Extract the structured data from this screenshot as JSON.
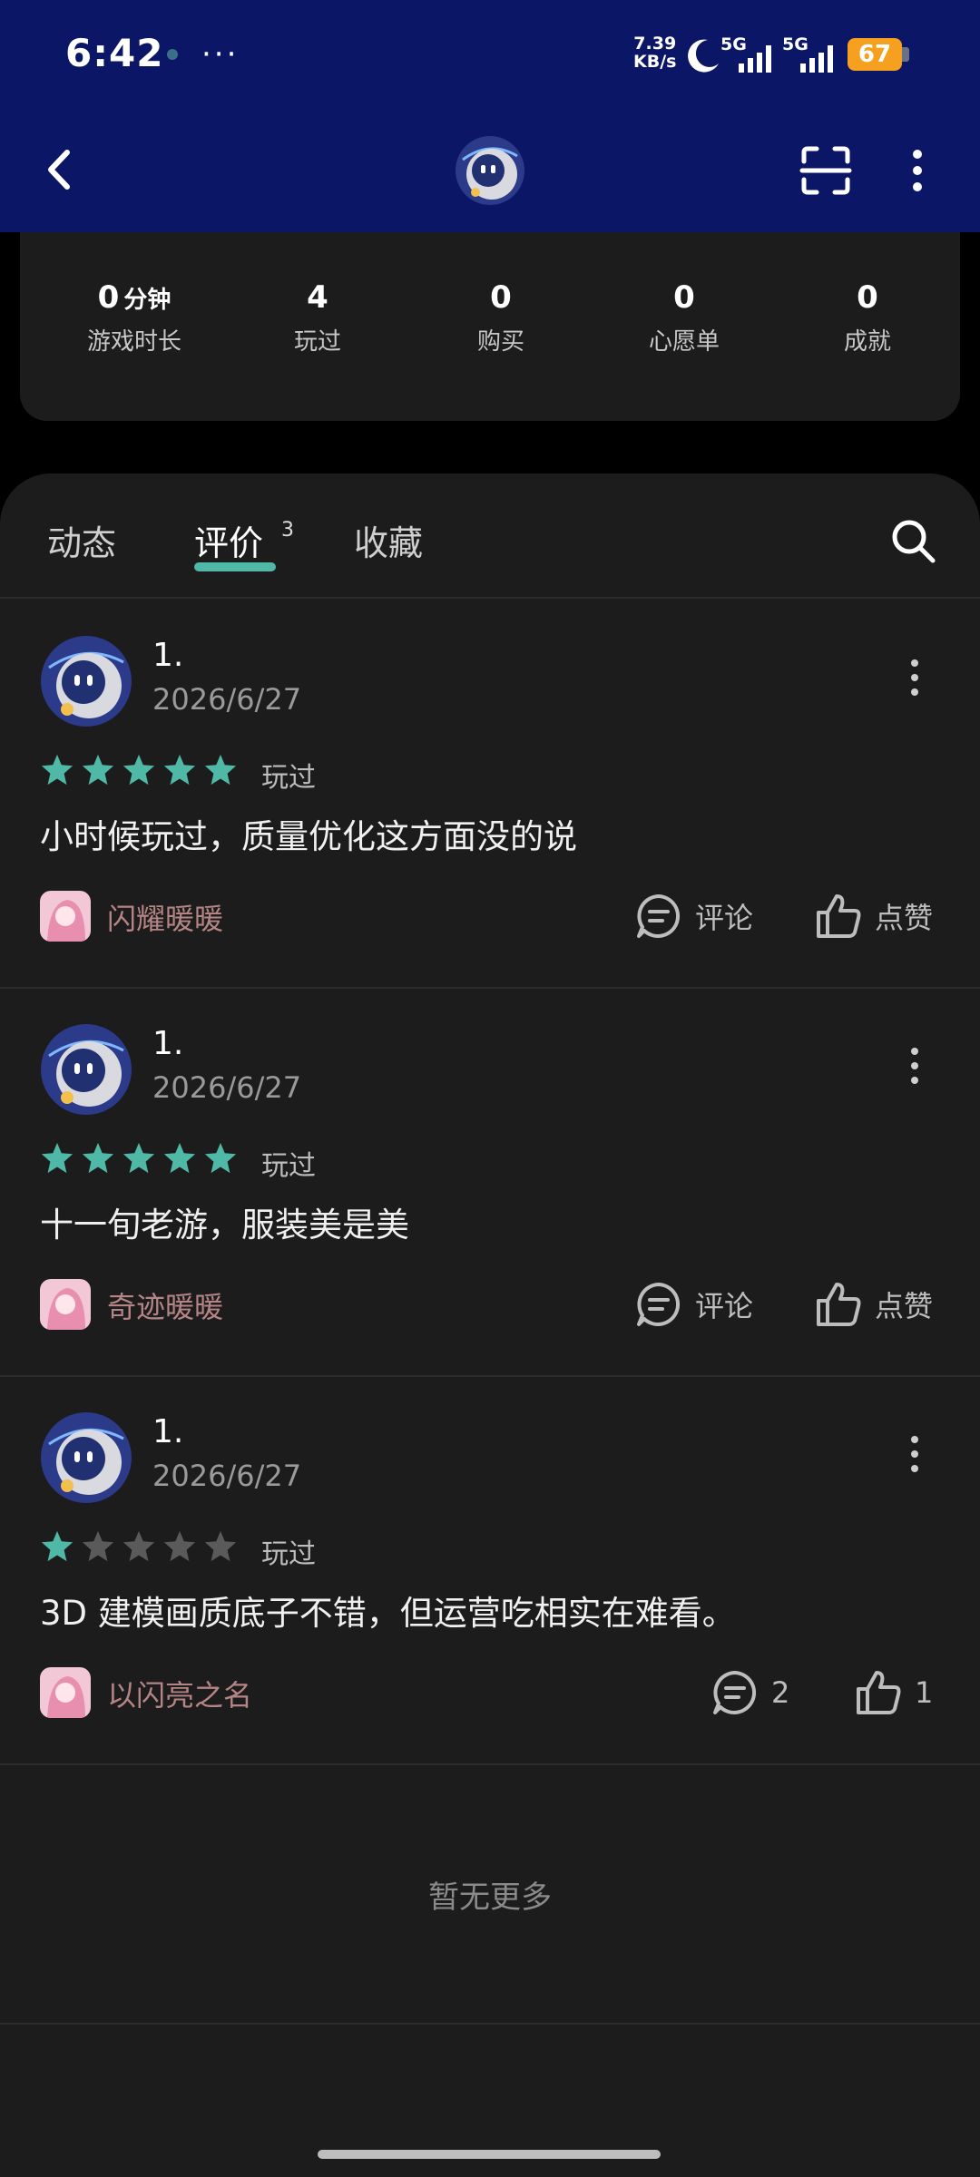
{
  "status_bar": {
    "time": "6:42",
    "more": "···",
    "net_speed_value": "7.39",
    "net_speed_unit": "KB/s",
    "sim1": "5G",
    "sim2": "5G",
    "battery": "67"
  },
  "nav": {
    "back_icon": "chevron-left-icon",
    "scan_icon": "scan-icon",
    "menu_icon": "more-vertical-icon"
  },
  "stats": [
    {
      "value": "0",
      "unit": "分钟",
      "label": "游戏时长"
    },
    {
      "value": "4",
      "unit": "",
      "label": "玩过"
    },
    {
      "value": "0",
      "unit": "",
      "label": "购买"
    },
    {
      "value": "0",
      "unit": "",
      "label": "心愿单"
    },
    {
      "value": "0",
      "unit": "",
      "label": "成就"
    }
  ],
  "tabs": [
    {
      "label": "动态"
    },
    {
      "label": "评价",
      "count": "3"
    },
    {
      "label": "收藏"
    }
  ],
  "colors": {
    "accent": "#4fb8a6",
    "header_bg": "#0b1766",
    "card_bg": "#1c1c1c",
    "star_off": "#5a5a5a"
  },
  "reviews": [
    {
      "name": "1.",
      "date": "2026/6/27",
      "rating": 5,
      "status": "玩过",
      "text": "小时候玩过，质量优化这方面没的说",
      "game": "闪耀暖暖",
      "comment_label": "评论",
      "like_label": "点赞"
    },
    {
      "name": "1.",
      "date": "2026/6/27",
      "rating": 5,
      "status": "玩过",
      "text": "十一旬老游，服装美是美",
      "game": "奇迹暖暖",
      "comment_label": "评论",
      "like_label": "点赞"
    },
    {
      "name": "1.",
      "date": "2026/6/27",
      "rating": 1,
      "status": "玩过",
      "text": "3D 建模画质底子不错，但运营吃相实在难看。",
      "game": "以闪亮之名",
      "comment_label": "2",
      "like_label": "1"
    }
  ],
  "footer": {
    "no_more": "暂无更多"
  }
}
